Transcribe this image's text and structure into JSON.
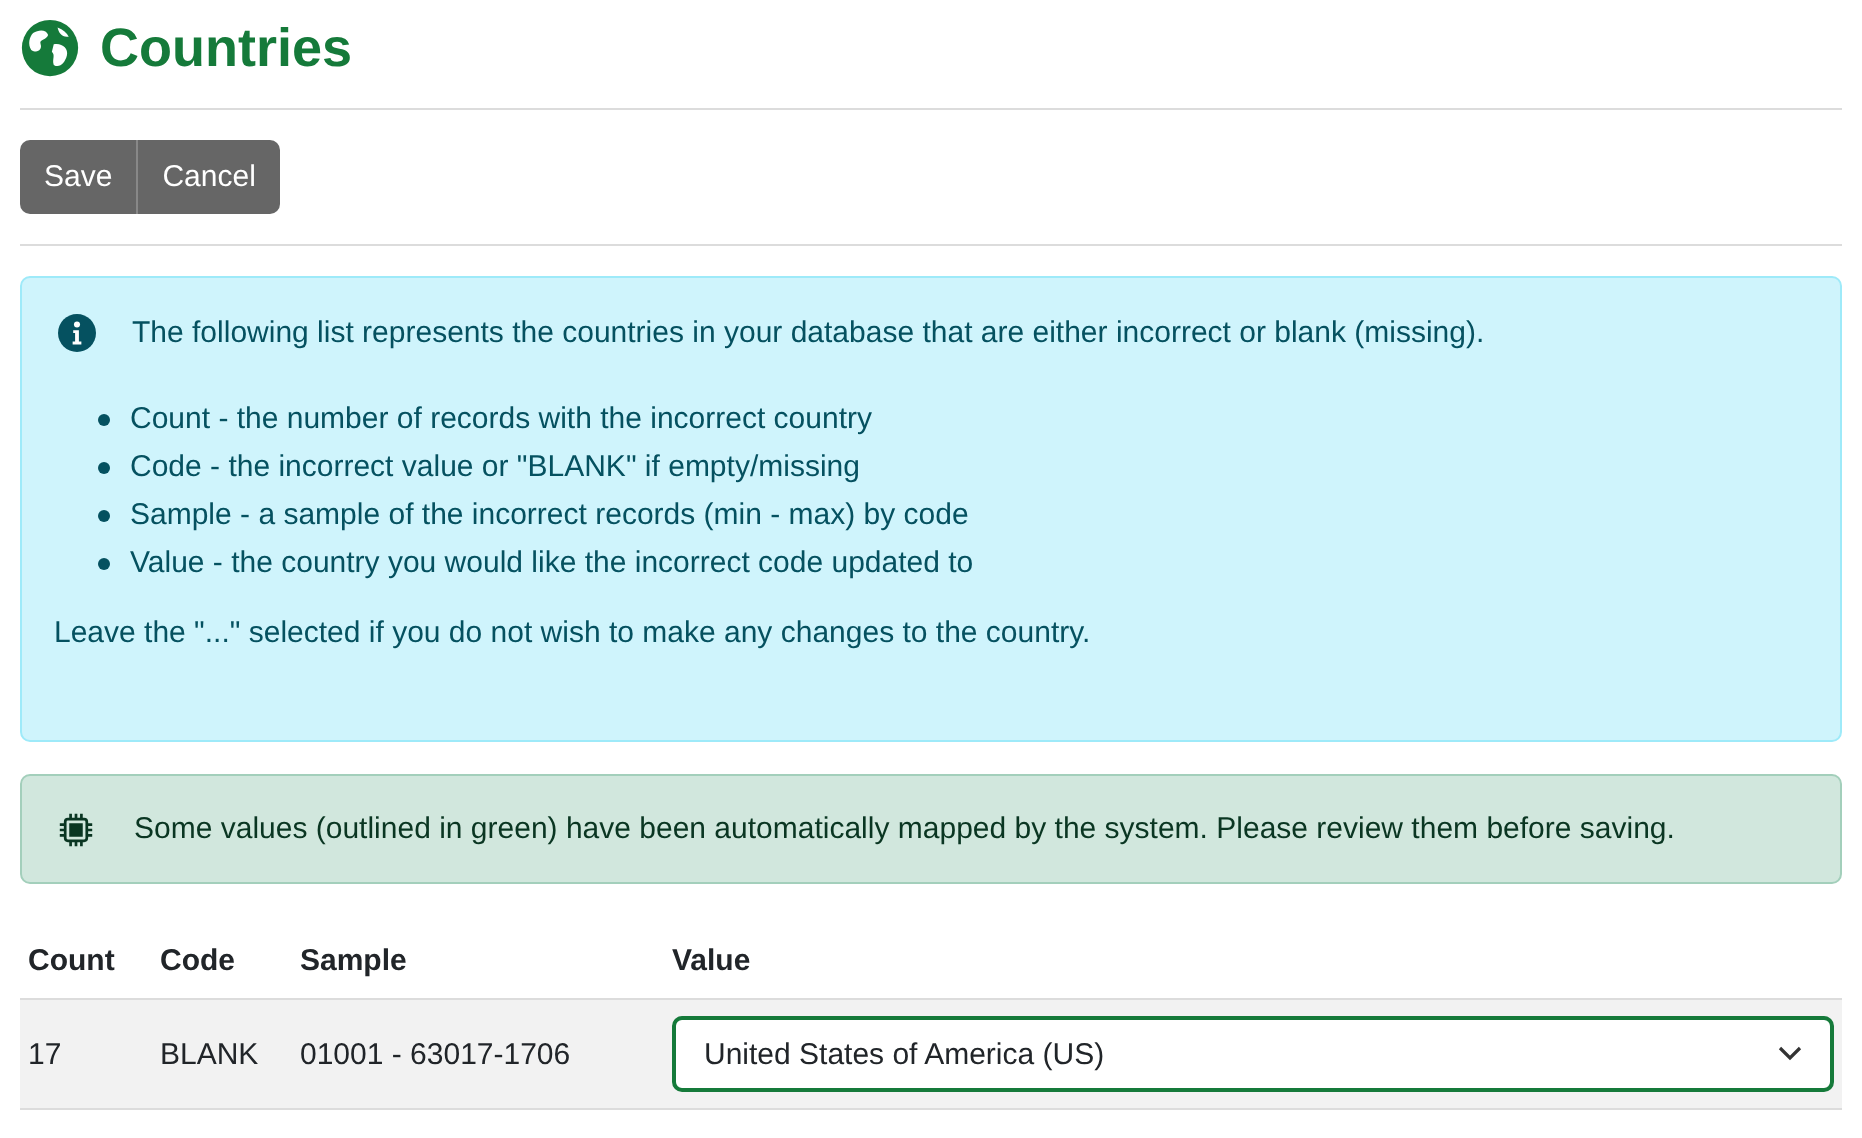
{
  "title": "Countries",
  "buttons": [
    "Save",
    "Cancel"
  ],
  "info": {
    "intro": "The following list represents the countries in your database that are either incorrect or blank (missing).",
    "items": [
      "Count - the number of records with the incorrect country",
      "Code - the incorrect value or \"BLANK\" if empty/missing",
      "Sample - a sample of the incorrect records (min - max) by code",
      "Value - the country you would like the incorrect code updated to"
    ],
    "footer": "Leave the \"...\" selected if you do not wish to make any changes to the country."
  },
  "notice": "Some values (outlined in green) have been automatically mapped by the system. Please review them before saving.",
  "table": {
    "columns": [
      "Count",
      "Code",
      "Sample",
      "Value"
    ],
    "rows": [
      {
        "count": "17",
        "code": "BLANK",
        "sample": "01001 - 63017-1706",
        "value": "United States of America (US)",
        "auto_mapped": true
      }
    ]
  }
}
